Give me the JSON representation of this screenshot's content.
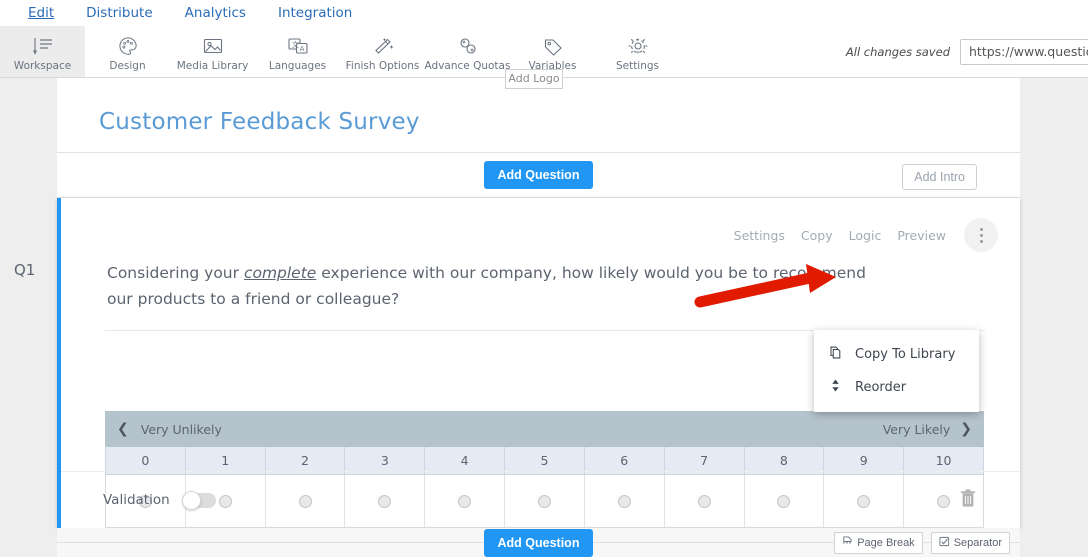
{
  "topnav": {
    "items": [
      {
        "label": "Edit",
        "active": true
      },
      {
        "label": "Distribute",
        "active": false
      },
      {
        "label": "Analytics",
        "active": false
      },
      {
        "label": "Integration",
        "active": false
      }
    ]
  },
  "toolbar": {
    "tools": [
      {
        "label": "Workspace",
        "icon": "workspace-icon",
        "active": true
      },
      {
        "label": "Design",
        "icon": "palette-icon",
        "active": false
      },
      {
        "label": "Media Library",
        "icon": "image-icon",
        "active": false
      },
      {
        "label": "Languages",
        "icon": "translate-icon",
        "active": false
      },
      {
        "label": "Finish Options",
        "icon": "magic-wand-icon",
        "active": false
      },
      {
        "label": "Advance Quotas",
        "icon": "link-chain-icon",
        "active": false
      },
      {
        "label": "Variables",
        "icon": "tag-icon",
        "active": false
      },
      {
        "label": "Settings",
        "icon": "gear-icon",
        "active": false
      }
    ],
    "saved_note": "All changes saved",
    "url_value": "https://www.question"
  },
  "header_card": {
    "add_logo_label": "Add Logo",
    "survey_title": "Customer Feedback Survey"
  },
  "add_question_strip": {
    "add_question_label": "Add Question",
    "add_intro_label": "Add Intro"
  },
  "question": {
    "number_label": "Q1",
    "actions": [
      {
        "label": "Settings"
      },
      {
        "label": "Copy"
      },
      {
        "label": "Logic"
      },
      {
        "label": "Preview"
      }
    ],
    "text_part1": "Considering your ",
    "text_emphasis": "complete",
    "text_part2": " experience with our company, how likely would you be to recommend our products to a friend or colleague?",
    "scale": {
      "left_label": "Very Unlikely",
      "right_label": "Very Likely",
      "numbers": [
        "0",
        "1",
        "2",
        "3",
        "4",
        "5",
        "6",
        "7",
        "8",
        "9",
        "10"
      ]
    },
    "validation_label": "Validation",
    "validation_on": false,
    "delete_icon": "trash-icon"
  },
  "dropdown": {
    "items": [
      {
        "label": "Copy To Library",
        "icon": "copy-pages-icon"
      },
      {
        "label": "Reorder",
        "icon": "up-down-arrows-icon"
      }
    ]
  },
  "bottom_bar": {
    "add_question_label": "Add Question",
    "page_break_label": "Page Break",
    "separator_label": "Separator"
  },
  "colors": {
    "accent_blue": "#2196f3",
    "title_blue": "#5b9bd5",
    "nav_link": "#2b6cb8",
    "scale_header": "#b5c3cd",
    "scale_numbers_bg": "#e4ebf3",
    "annotation_red": "#e01b00"
  }
}
